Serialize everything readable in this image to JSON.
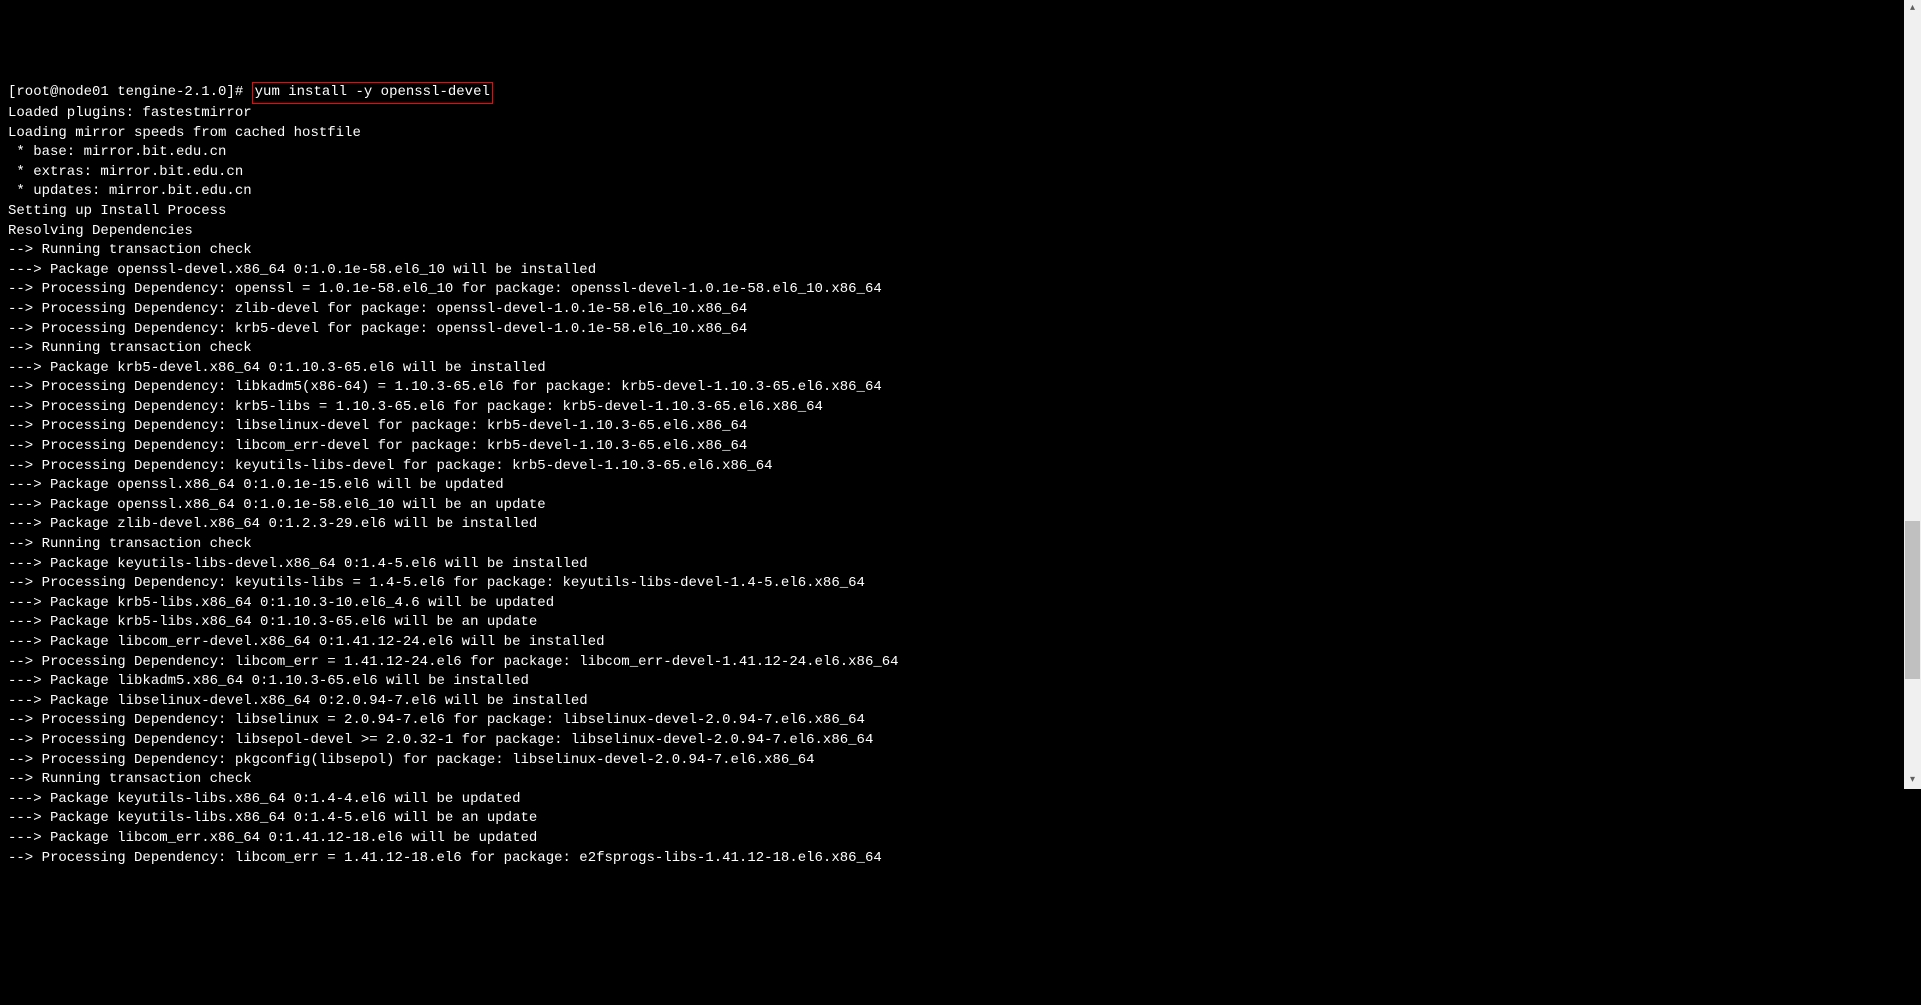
{
  "prompt": "[root@node01 tengine-2.1.0]# ",
  "command": "yum install -y openssl-devel",
  "output_lines": [
    "Loaded plugins: fastestmirror",
    "Loading mirror speeds from cached hostfile",
    " * base: mirror.bit.edu.cn",
    " * extras: mirror.bit.edu.cn",
    " * updates: mirror.bit.edu.cn",
    "Setting up Install Process",
    "Resolving Dependencies",
    "--> Running transaction check",
    "---> Package openssl-devel.x86_64 0:1.0.1e-58.el6_10 will be installed",
    "--> Processing Dependency: openssl = 1.0.1e-58.el6_10 for package: openssl-devel-1.0.1e-58.el6_10.x86_64",
    "--> Processing Dependency: zlib-devel for package: openssl-devel-1.0.1e-58.el6_10.x86_64",
    "--> Processing Dependency: krb5-devel for package: openssl-devel-1.0.1e-58.el6_10.x86_64",
    "--> Running transaction check",
    "---> Package krb5-devel.x86_64 0:1.10.3-65.el6 will be installed",
    "--> Processing Dependency: libkadm5(x86-64) = 1.10.3-65.el6 for package: krb5-devel-1.10.3-65.el6.x86_64",
    "--> Processing Dependency: krb5-libs = 1.10.3-65.el6 for package: krb5-devel-1.10.3-65.el6.x86_64",
    "--> Processing Dependency: libselinux-devel for package: krb5-devel-1.10.3-65.el6.x86_64",
    "--> Processing Dependency: libcom_err-devel for package: krb5-devel-1.10.3-65.el6.x86_64",
    "--> Processing Dependency: keyutils-libs-devel for package: krb5-devel-1.10.3-65.el6.x86_64",
    "---> Package openssl.x86_64 0:1.0.1e-15.el6 will be updated",
    "---> Package openssl.x86_64 0:1.0.1e-58.el6_10 will be an update",
    "---> Package zlib-devel.x86_64 0:1.2.3-29.el6 will be installed",
    "--> Running transaction check",
    "---> Package keyutils-libs-devel.x86_64 0:1.4-5.el6 will be installed",
    "--> Processing Dependency: keyutils-libs = 1.4-5.el6 for package: keyutils-libs-devel-1.4-5.el6.x86_64",
    "---> Package krb5-libs.x86_64 0:1.10.3-10.el6_4.6 will be updated",
    "---> Package krb5-libs.x86_64 0:1.10.3-65.el6 will be an update",
    "---> Package libcom_err-devel.x86_64 0:1.41.12-24.el6 will be installed",
    "--> Processing Dependency: libcom_err = 1.41.12-24.el6 for package: libcom_err-devel-1.41.12-24.el6.x86_64",
    "---> Package libkadm5.x86_64 0:1.10.3-65.el6 will be installed",
    "---> Package libselinux-devel.x86_64 0:2.0.94-7.el6 will be installed",
    "--> Processing Dependency: libselinux = 2.0.94-7.el6 for package: libselinux-devel-2.0.94-7.el6.x86_64",
    "--> Processing Dependency: libsepol-devel >= 2.0.32-1 for package: libselinux-devel-2.0.94-7.el6.x86_64",
    "--> Processing Dependency: pkgconfig(libsepol) for package: libselinux-devel-2.0.94-7.el6.x86_64",
    "--> Running transaction check",
    "---> Package keyutils-libs.x86_64 0:1.4-4.el6 will be updated",
    "---> Package keyutils-libs.x86_64 0:1.4-5.el6 will be an update",
    "---> Package libcom_err.x86_64 0:1.41.12-18.el6 will be updated",
    "--> Processing Dependency: libcom_err = 1.41.12-18.el6 for package: e2fsprogs-libs-1.41.12-18.el6.x86_64"
  ]
}
